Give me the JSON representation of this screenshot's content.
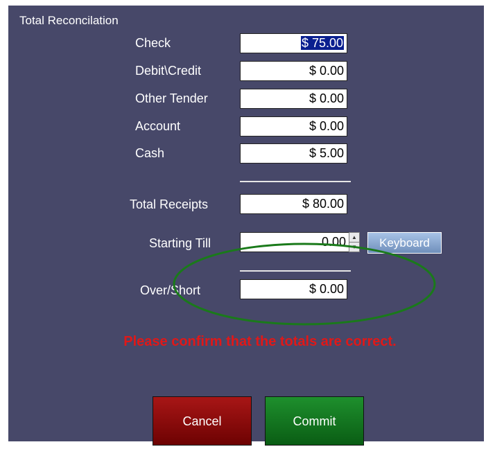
{
  "title": "Total Reconcilation",
  "fields": [
    {
      "label": "Check",
      "value": "$ 75.00"
    },
    {
      "label": "Debit\\Credit",
      "value": "$ 0.00"
    },
    {
      "label": "Other Tender",
      "value": "$ 0.00"
    },
    {
      "label": "Account",
      "value": "$ 0.00"
    },
    {
      "label": "Cash",
      "value": "$ 5.00"
    }
  ],
  "total_receipts": {
    "label": "Total Receipts",
    "value": "$ 80.00"
  },
  "starting_till": {
    "label": "Starting Till",
    "value": "0.00"
  },
  "keyboard_label": "Keyboard",
  "over_short": {
    "label": "Over/Short",
    "value": "$ 0.00"
  },
  "warning_text": "Please confirm that the totals are correct.",
  "buttons": {
    "cancel": "Cancel",
    "commit": "Commit"
  },
  "colors": {
    "panel": "#474869",
    "warning": "#e01818",
    "annotation_ellipse": "#1a7a1a"
  }
}
